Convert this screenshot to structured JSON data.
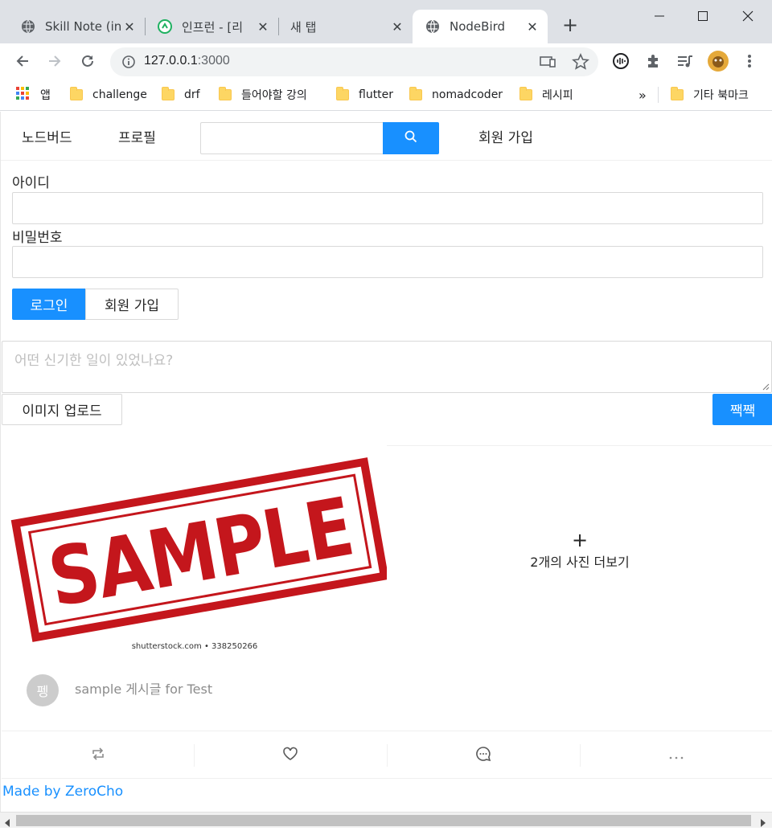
{
  "browser": {
    "tabs": [
      {
        "title": "Skill Note (in",
        "active": false
      },
      {
        "title": "인프런 - [리",
        "active": false
      },
      {
        "title": "새 탭",
        "active": false
      },
      {
        "title": "NodeBird",
        "active": true
      }
    ],
    "url_host": "127.0.0.1",
    "url_port": ":3000",
    "bookmarks": [
      {
        "label": "앱"
      },
      {
        "label": "challenge"
      },
      {
        "label": "drf"
      },
      {
        "label": "들어야할 강의"
      },
      {
        "label": "flutter"
      },
      {
        "label": "nomadcoder"
      },
      {
        "label": "레시피"
      },
      {
        "label": "»"
      },
      {
        "label": "기타 북마크"
      }
    ]
  },
  "nav": {
    "home": "노드버드",
    "profile": "프로필",
    "signup": "회원 가입",
    "search_placeholder": ""
  },
  "login": {
    "id_label": "아이디",
    "id_value": "",
    "password_label": "비밀번호",
    "password_value": "",
    "login_button": "로그인",
    "signup_button": "회원 가입"
  },
  "post_form": {
    "placeholder": "어떤 신기한 일이 있었나요?",
    "upload_button": "이미지 업로드",
    "submit_button": "짹짹"
  },
  "post": {
    "image_text": "SAMPLE",
    "image_caption": "shutterstock.com • 338250266",
    "more_photos": "2개의 사진 더보기",
    "more_icon": "+",
    "author_initial": "펭",
    "content": "sample 게시글 for Test",
    "actions": [
      "retweet-icon",
      "heart-icon",
      "message-icon",
      "ellipsis-icon"
    ]
  },
  "footer": {
    "link": "Made by ZeroCho"
  },
  "colors": {
    "primary": "#1890ff",
    "stamp_red": "#c4161c"
  }
}
